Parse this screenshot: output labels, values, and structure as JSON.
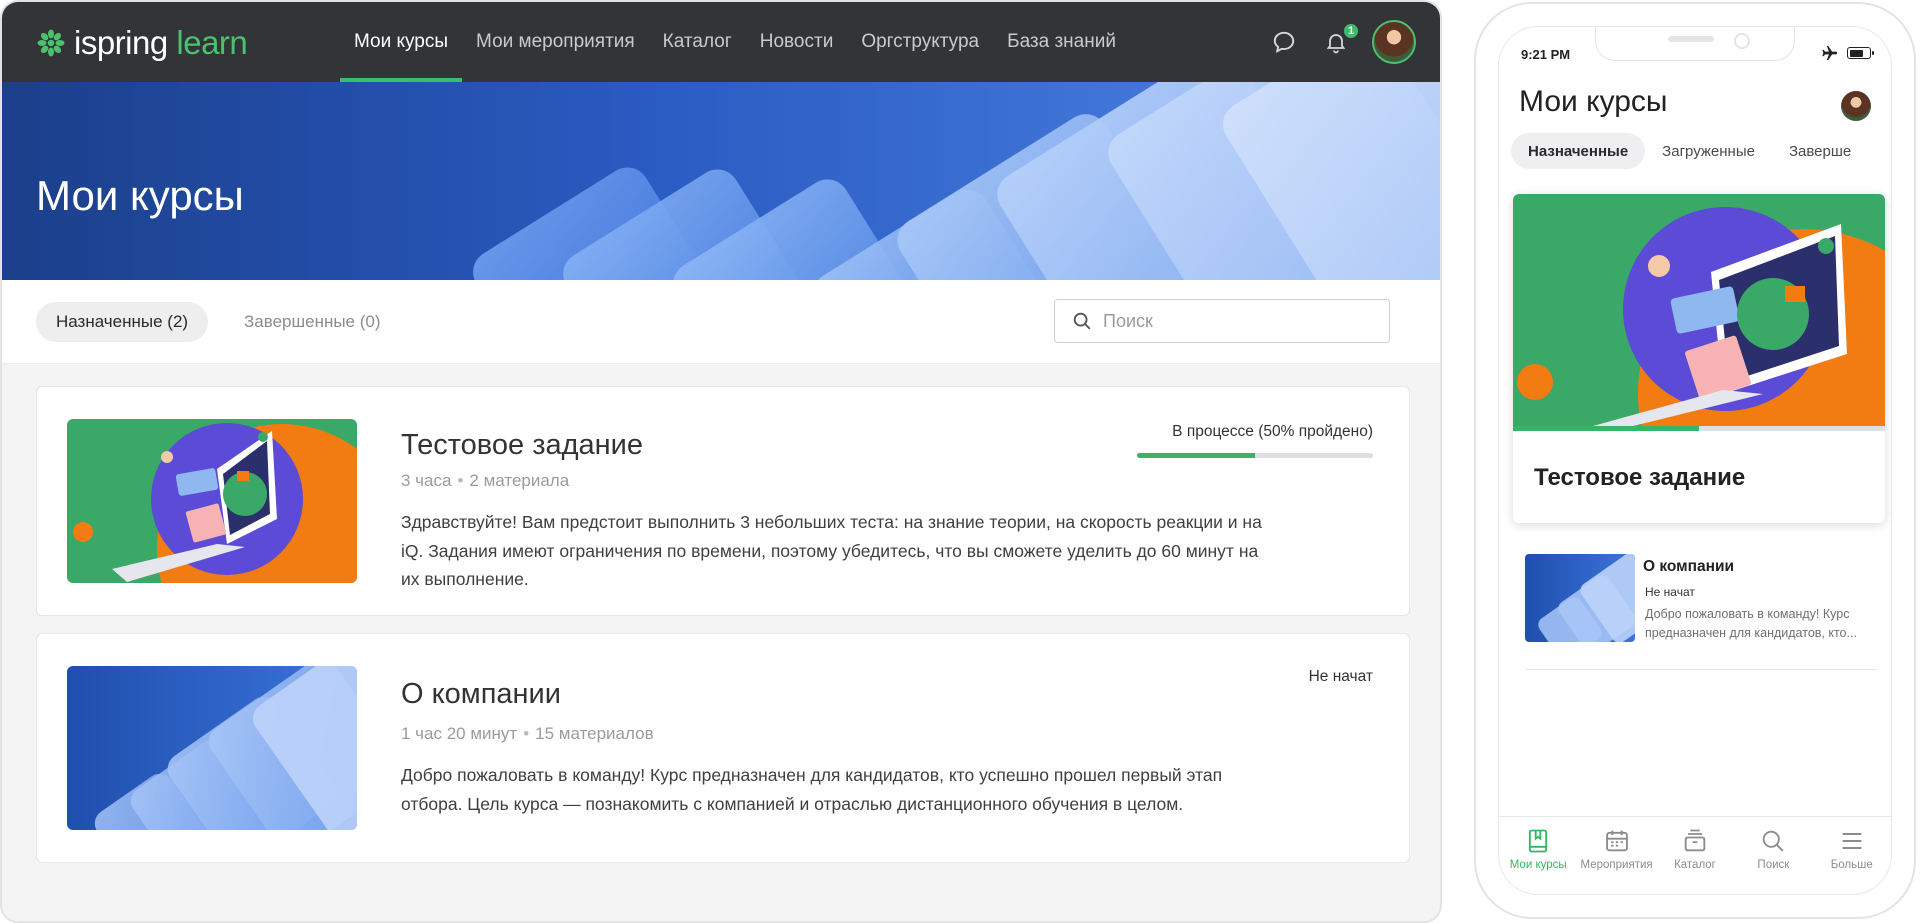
{
  "app": {
    "logo_word": "ispring",
    "logo_accent": "learn"
  },
  "nav": [
    {
      "label": "Мои курсы",
      "active": true
    },
    {
      "label": "Мои мероприятия"
    },
    {
      "label": "Каталог"
    },
    {
      "label": "Новости"
    },
    {
      "label": "Оргструктура"
    },
    {
      "label": "База знаний"
    }
  ],
  "header": {
    "icons": [
      "chat-icon",
      "bell-icon"
    ],
    "notification_count": "1"
  },
  "hero": {
    "title": "Мои курсы"
  },
  "tabs": {
    "assigned": "Назначенные (2)",
    "completed": "Завершенные (0)"
  },
  "search": {
    "placeholder": "Поиск"
  },
  "courses": [
    {
      "title": "Тестовое задание",
      "duration": "3 часа",
      "materials": "2 материала",
      "description": "Здравствуйте! Вам предстоит выполнить 3 небольших теста: на знание теории, на скорость реакции и на iQ. Задания имеют ограничения по времени, поэтому убедитесь, что вы сможете уделить до 60 минут на их выполнение.",
      "status": "В процессе (50% пройдено)",
      "progress": 0.5
    },
    {
      "title": "О компании",
      "duration": "1 час 20 минут",
      "materials": "15 материалов",
      "description": "Добро пожаловать в команду! Курс предназначен для кандидатов, кто успешно прошел первый этап отбора. Цель курса — познакомить с компанией и отраслью дистанционного обучения в целом.",
      "status": "Не начат"
    }
  ],
  "mobile": {
    "time": "9:21 PM",
    "title": "Мои курсы",
    "tabs": [
      "Назначенные",
      "Загруженные",
      "Заверше"
    ],
    "featured": {
      "title": "Тестовое задание",
      "progress": 0.5
    },
    "item": {
      "title": "О компании",
      "status": "Не начат",
      "description": "Добро пожаловать в команду! Курс предназначен для кандидатов, кто..."
    },
    "bottom_nav": [
      {
        "label": "Мои курсы",
        "icon": "book-icon",
        "active": true
      },
      {
        "label": "Мероприятия",
        "icon": "calendar-icon"
      },
      {
        "label": "Каталог",
        "icon": "catalog-icon"
      },
      {
        "label": "Поиск",
        "icon": "search-icon"
      },
      {
        "label": "Больше",
        "icon": "menu-icon"
      }
    ]
  },
  "colors": {
    "accent": "#3fbc6a",
    "topbar": "#323438",
    "hero_dark": "#1b3f8a",
    "hero_light": "#4f86e4",
    "illustration_green": "#3aa866",
    "illustration_orange": "#f27b12",
    "illustration_purple": "#5b4bd6"
  }
}
